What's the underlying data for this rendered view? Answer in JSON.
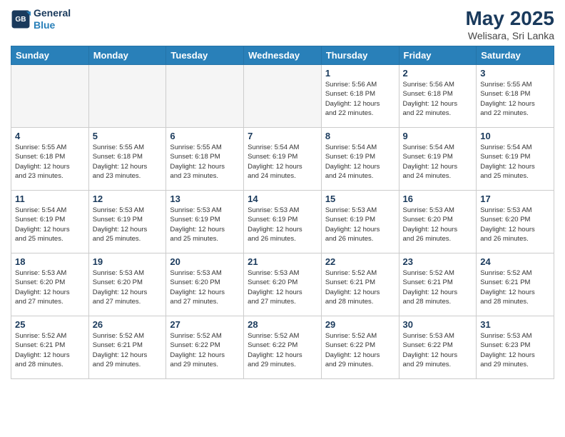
{
  "logo": {
    "line1": "General",
    "line2": "Blue"
  },
  "title": "May 2025",
  "subtitle": "Welisara, Sri Lanka",
  "days_header": [
    "Sunday",
    "Monday",
    "Tuesday",
    "Wednesday",
    "Thursday",
    "Friday",
    "Saturday"
  ],
  "weeks": [
    [
      {
        "day": "",
        "info": ""
      },
      {
        "day": "",
        "info": ""
      },
      {
        "day": "",
        "info": ""
      },
      {
        "day": "",
        "info": ""
      },
      {
        "day": "1",
        "info": "Sunrise: 5:56 AM\nSunset: 6:18 PM\nDaylight: 12 hours\nand 22 minutes."
      },
      {
        "day": "2",
        "info": "Sunrise: 5:56 AM\nSunset: 6:18 PM\nDaylight: 12 hours\nand 22 minutes."
      },
      {
        "day": "3",
        "info": "Sunrise: 5:55 AM\nSunset: 6:18 PM\nDaylight: 12 hours\nand 22 minutes."
      }
    ],
    [
      {
        "day": "4",
        "info": "Sunrise: 5:55 AM\nSunset: 6:18 PM\nDaylight: 12 hours\nand 23 minutes."
      },
      {
        "day": "5",
        "info": "Sunrise: 5:55 AM\nSunset: 6:18 PM\nDaylight: 12 hours\nand 23 minutes."
      },
      {
        "day": "6",
        "info": "Sunrise: 5:55 AM\nSunset: 6:18 PM\nDaylight: 12 hours\nand 23 minutes."
      },
      {
        "day": "7",
        "info": "Sunrise: 5:54 AM\nSunset: 6:19 PM\nDaylight: 12 hours\nand 24 minutes."
      },
      {
        "day": "8",
        "info": "Sunrise: 5:54 AM\nSunset: 6:19 PM\nDaylight: 12 hours\nand 24 minutes."
      },
      {
        "day": "9",
        "info": "Sunrise: 5:54 AM\nSunset: 6:19 PM\nDaylight: 12 hours\nand 24 minutes."
      },
      {
        "day": "10",
        "info": "Sunrise: 5:54 AM\nSunset: 6:19 PM\nDaylight: 12 hours\nand 25 minutes."
      }
    ],
    [
      {
        "day": "11",
        "info": "Sunrise: 5:54 AM\nSunset: 6:19 PM\nDaylight: 12 hours\nand 25 minutes."
      },
      {
        "day": "12",
        "info": "Sunrise: 5:53 AM\nSunset: 6:19 PM\nDaylight: 12 hours\nand 25 minutes."
      },
      {
        "day": "13",
        "info": "Sunrise: 5:53 AM\nSunset: 6:19 PM\nDaylight: 12 hours\nand 25 minutes."
      },
      {
        "day": "14",
        "info": "Sunrise: 5:53 AM\nSunset: 6:19 PM\nDaylight: 12 hours\nand 26 minutes."
      },
      {
        "day": "15",
        "info": "Sunrise: 5:53 AM\nSunset: 6:19 PM\nDaylight: 12 hours\nand 26 minutes."
      },
      {
        "day": "16",
        "info": "Sunrise: 5:53 AM\nSunset: 6:20 PM\nDaylight: 12 hours\nand 26 minutes."
      },
      {
        "day": "17",
        "info": "Sunrise: 5:53 AM\nSunset: 6:20 PM\nDaylight: 12 hours\nand 26 minutes."
      }
    ],
    [
      {
        "day": "18",
        "info": "Sunrise: 5:53 AM\nSunset: 6:20 PM\nDaylight: 12 hours\nand 27 minutes."
      },
      {
        "day": "19",
        "info": "Sunrise: 5:53 AM\nSunset: 6:20 PM\nDaylight: 12 hours\nand 27 minutes."
      },
      {
        "day": "20",
        "info": "Sunrise: 5:53 AM\nSunset: 6:20 PM\nDaylight: 12 hours\nand 27 minutes."
      },
      {
        "day": "21",
        "info": "Sunrise: 5:53 AM\nSunset: 6:20 PM\nDaylight: 12 hours\nand 27 minutes."
      },
      {
        "day": "22",
        "info": "Sunrise: 5:52 AM\nSunset: 6:21 PM\nDaylight: 12 hours\nand 28 minutes."
      },
      {
        "day": "23",
        "info": "Sunrise: 5:52 AM\nSunset: 6:21 PM\nDaylight: 12 hours\nand 28 minutes."
      },
      {
        "day": "24",
        "info": "Sunrise: 5:52 AM\nSunset: 6:21 PM\nDaylight: 12 hours\nand 28 minutes."
      }
    ],
    [
      {
        "day": "25",
        "info": "Sunrise: 5:52 AM\nSunset: 6:21 PM\nDaylight: 12 hours\nand 28 minutes."
      },
      {
        "day": "26",
        "info": "Sunrise: 5:52 AM\nSunset: 6:21 PM\nDaylight: 12 hours\nand 29 minutes."
      },
      {
        "day": "27",
        "info": "Sunrise: 5:52 AM\nSunset: 6:22 PM\nDaylight: 12 hours\nand 29 minutes."
      },
      {
        "day": "28",
        "info": "Sunrise: 5:52 AM\nSunset: 6:22 PM\nDaylight: 12 hours\nand 29 minutes."
      },
      {
        "day": "29",
        "info": "Sunrise: 5:52 AM\nSunset: 6:22 PM\nDaylight: 12 hours\nand 29 minutes."
      },
      {
        "day": "30",
        "info": "Sunrise: 5:53 AM\nSunset: 6:22 PM\nDaylight: 12 hours\nand 29 minutes."
      },
      {
        "day": "31",
        "info": "Sunrise: 5:53 AM\nSunset: 6:23 PM\nDaylight: 12 hours\nand 29 minutes."
      }
    ]
  ]
}
